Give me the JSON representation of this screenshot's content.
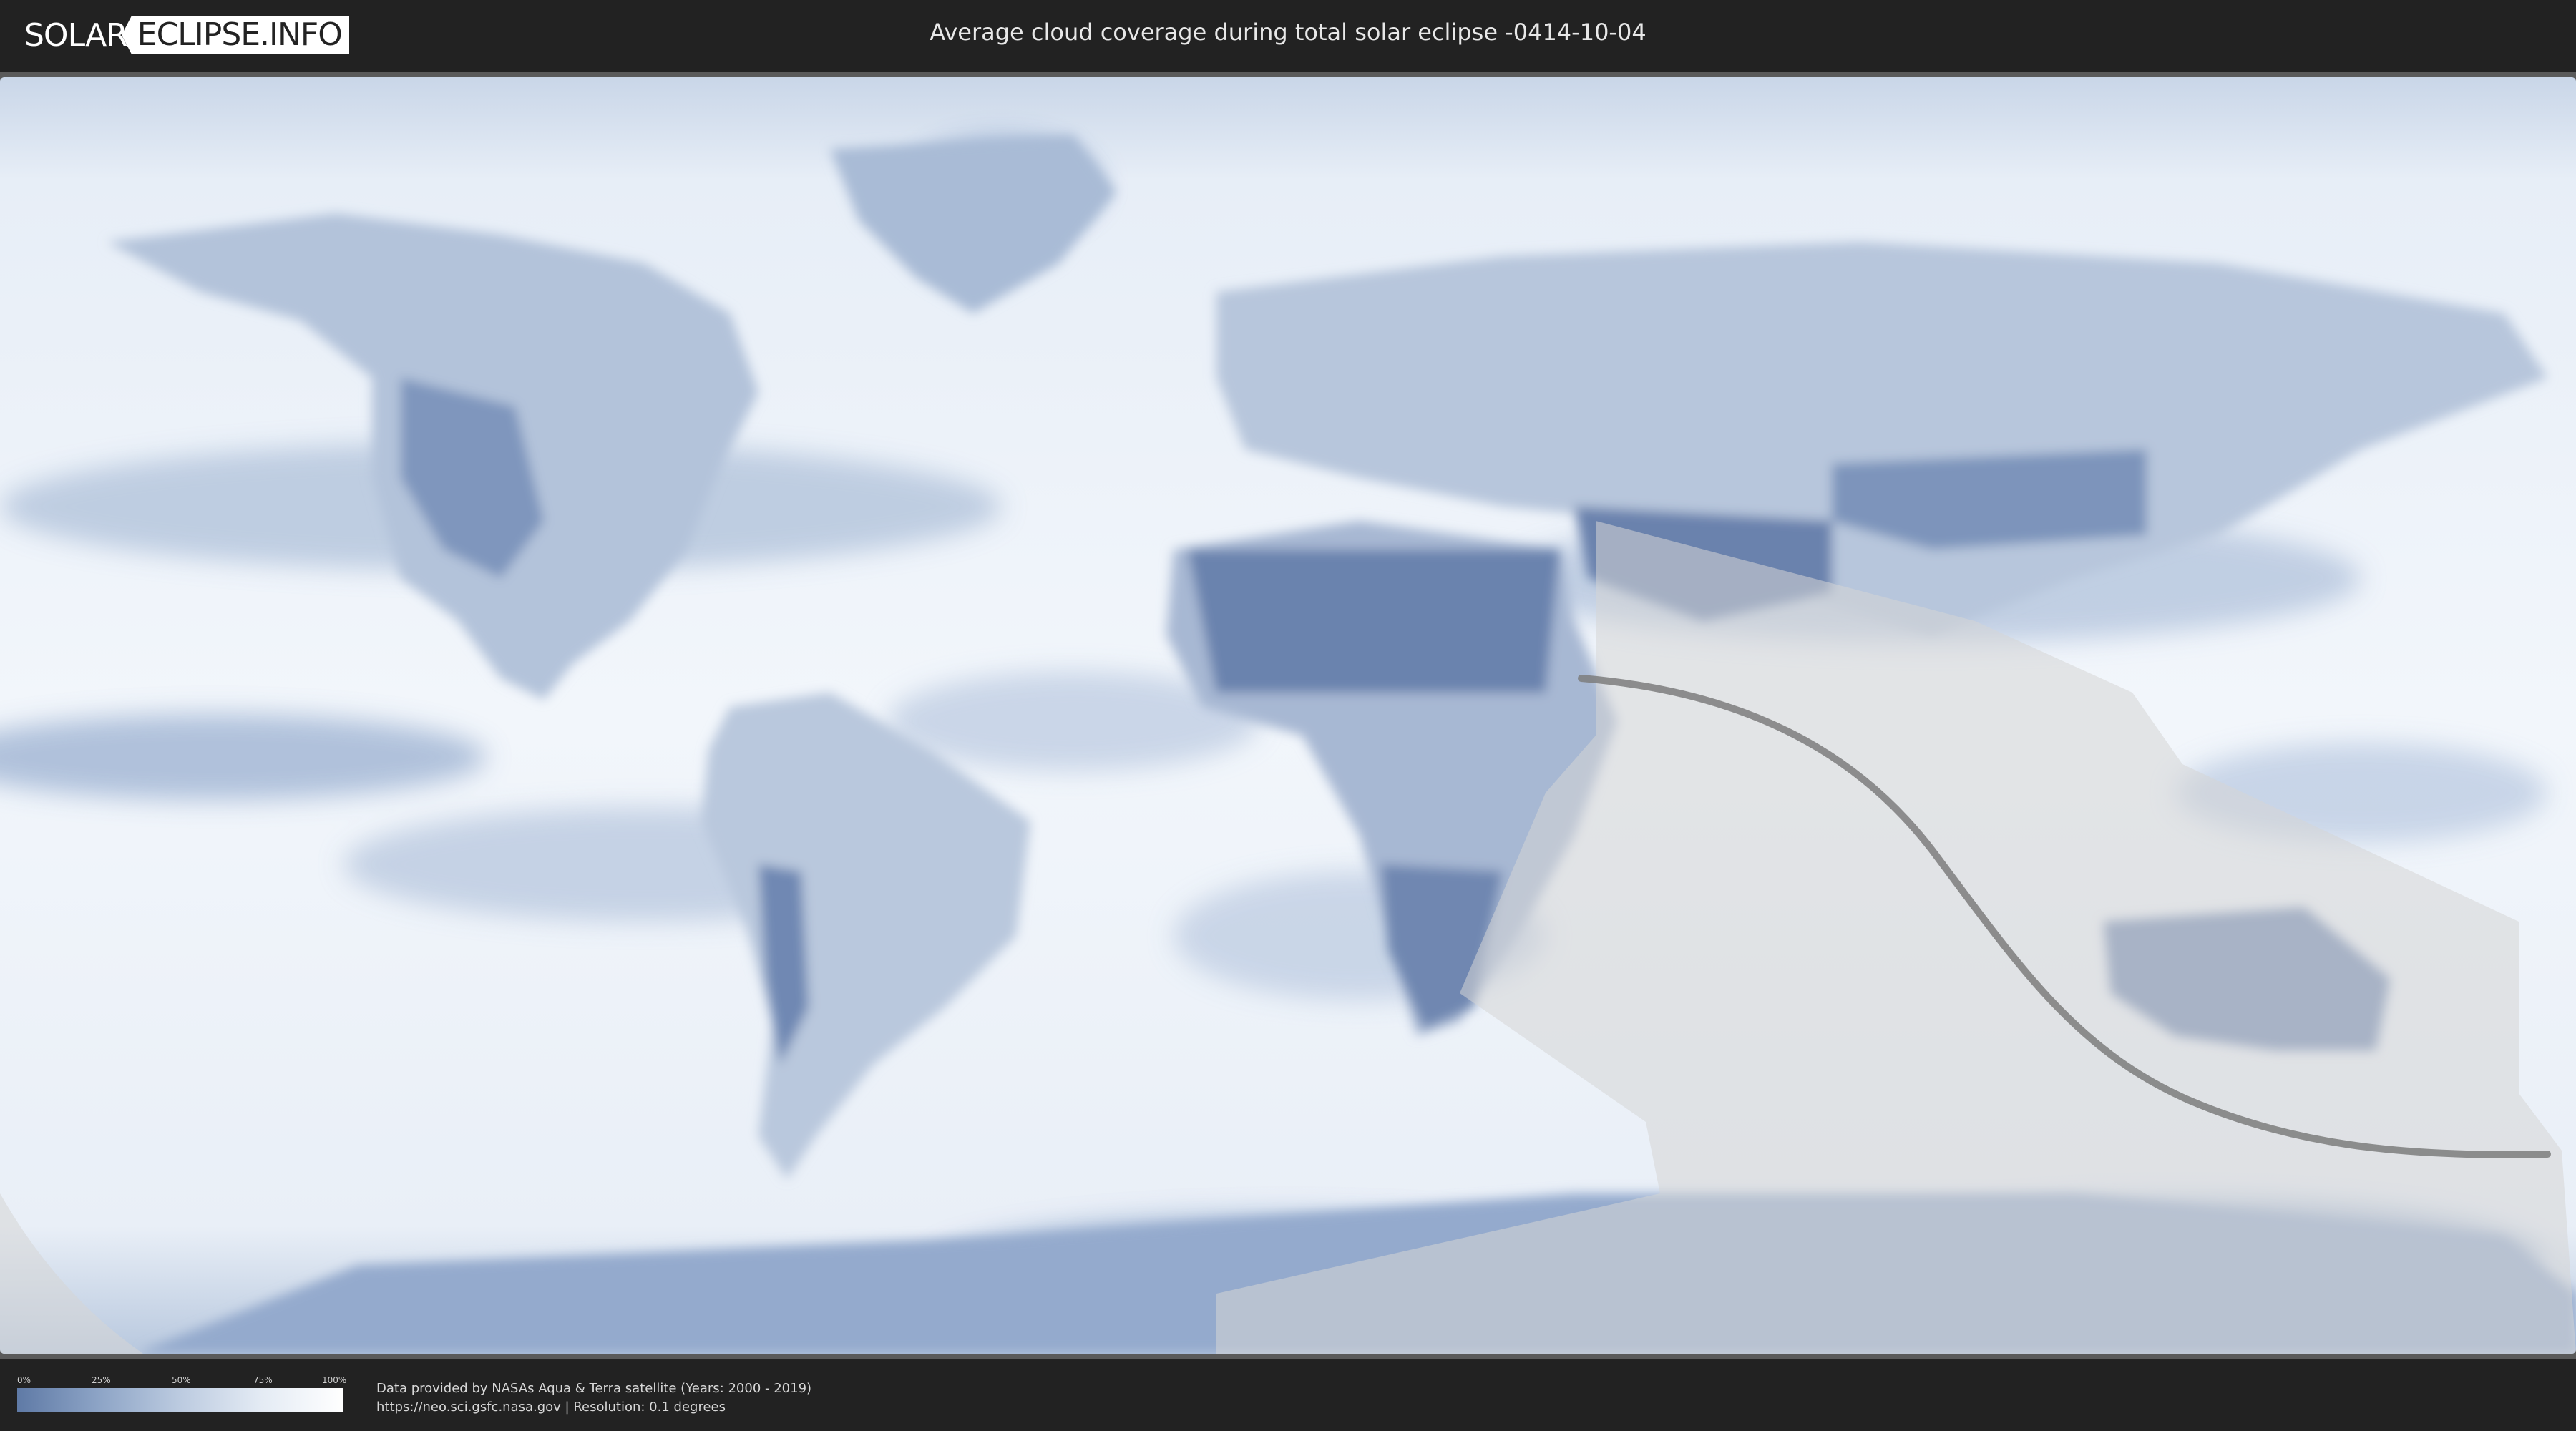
{
  "header": {
    "logo_left": "SOLAR",
    "logo_right": "ECLIPSE.INFO",
    "title": "Average cloud coverage during total solar eclipse -0414-10-04"
  },
  "legend": {
    "ticks": [
      "0%",
      "25%",
      "50%",
      "75%",
      "100%"
    ],
    "colors": {
      "low": "#5f7aa6",
      "high": "#ffffff"
    }
  },
  "credits": {
    "line1": "Data provided by NASAs Aqua & Terra satellite (Years: 2000 - 2019)",
    "line2": "https://neo.sci.gsfc.nasa.gov | Resolution: 0.1 degrees"
  },
  "map": {
    "colors": {
      "ocean_cloud": "#eef3f9",
      "clear_land": "#5e77a3",
      "eclipse_shade": "#d8d8d8",
      "path_line": "#7d7d7d"
    }
  }
}
